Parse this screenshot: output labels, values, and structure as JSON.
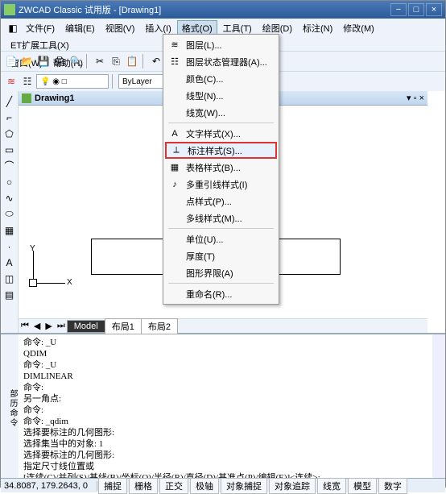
{
  "title": "ZWCAD Classic 试用版 - [Drawing1]",
  "menus": [
    "文件(F)",
    "编辑(E)",
    "视图(V)",
    "插入(I)",
    "格式(O)",
    "工具(T)",
    "绘图(D)",
    "标注(N)",
    "修改(M)",
    "ET扩展工具(X)",
    "窗口(W)",
    "帮助(H)"
  ],
  "doc_tab": "Drawing1",
  "layer_combo": "ByLayer",
  "format_menu": {
    "items": [
      {
        "icon": "≋",
        "label": "图层(L)..."
      },
      {
        "icon": "☷",
        "label": "图层状态管理器(A)..."
      },
      {
        "icon": "",
        "label": "颜色(C)..."
      },
      {
        "icon": "",
        "label": "线型(N)..."
      },
      {
        "icon": "",
        "label": "线宽(W)..."
      },
      {
        "sep": true
      },
      {
        "icon": "A",
        "label": "文字样式(X)..."
      },
      {
        "icon": "⟂",
        "label": "标注样式(S)...",
        "hl": true
      },
      {
        "icon": "▦",
        "label": "表格样式(B)..."
      },
      {
        "icon": "♪",
        "label": "多重引线样式(I)"
      },
      {
        "icon": "",
        "label": "点样式(P)..."
      },
      {
        "icon": "",
        "label": "多线样式(M)..."
      },
      {
        "sep": true
      },
      {
        "icon": "",
        "label": "单位(U)..."
      },
      {
        "icon": "",
        "label": "厚度(T)"
      },
      {
        "icon": "",
        "label": "图形界限(A)"
      },
      {
        "sep": true
      },
      {
        "icon": "",
        "label": "重命名(R)..."
      }
    ]
  },
  "model_tabs": [
    "Model",
    "布局1",
    "布局2"
  ],
  "axis": {
    "y": "Y",
    "x": "X"
  },
  "cmd_side": "部历命令",
  "cmd_text": "命令: _U\nQDIM\n命令: _U\nDIMLINEAR\n命令:\n另一角点:\n命令:\n命令: _qdim\n选择要标注的几何图形:\n选择集当中的对象: 1\n选择要标注的几何图形:\n指定尺寸线位置或\n[连续(C)/并列(S)/基线(B)/坐标(O)/半径(R)/直径(D)/基准点(P)/编辑(E)]<连续>:\n命令:",
  "coords": "34.8087, 179.2643, 0",
  "status_btns": [
    "捕捉",
    "栅格",
    "正交",
    "极轴",
    "对象捕捉",
    "对象追踪",
    "线宽",
    "模型",
    "数字"
  ]
}
